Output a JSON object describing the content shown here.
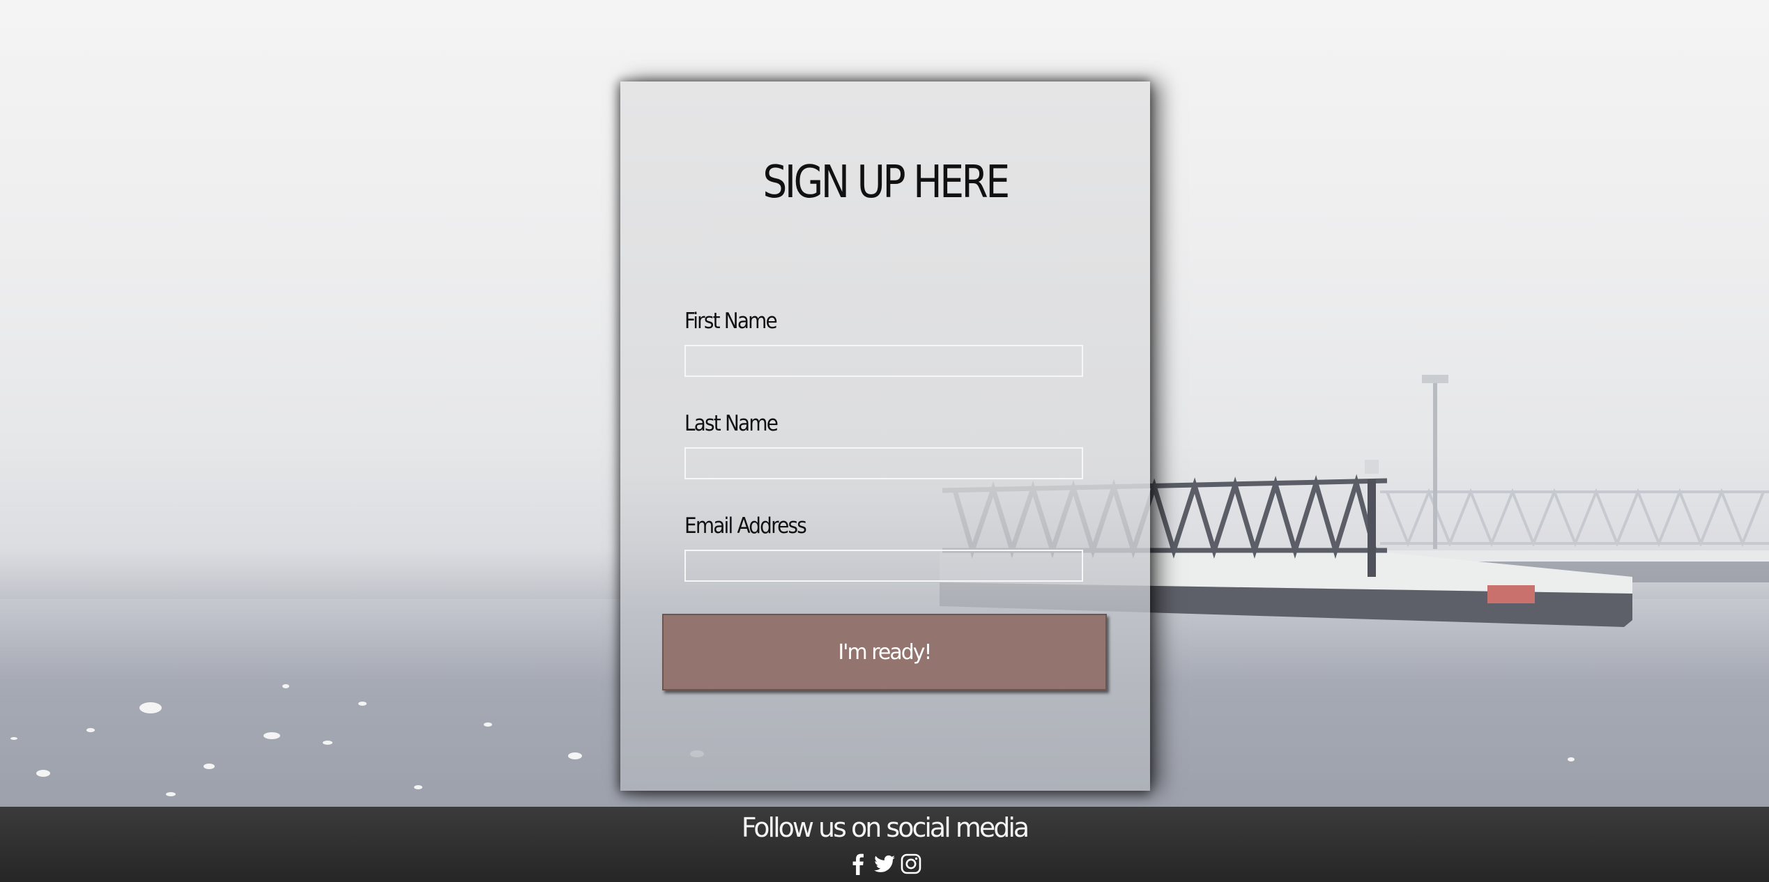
{
  "form": {
    "title": "SIGN UP HERE",
    "fields": [
      {
        "label": "First Name",
        "value": "",
        "placeholder": ""
      },
      {
        "label": "Last Name",
        "value": "",
        "placeholder": ""
      },
      {
        "label": "Email Address",
        "value": "",
        "placeholder": ""
      }
    ],
    "submit_label": "I'm ready!"
  },
  "footer": {
    "title": "Follow us on social media",
    "social_icons": [
      "facebook-icon",
      "twitter-icon",
      "instagram-icon"
    ]
  },
  "colors": {
    "button": "#94746e",
    "footer": "#2e2e2e",
    "input_border": "#f7f7f7"
  }
}
